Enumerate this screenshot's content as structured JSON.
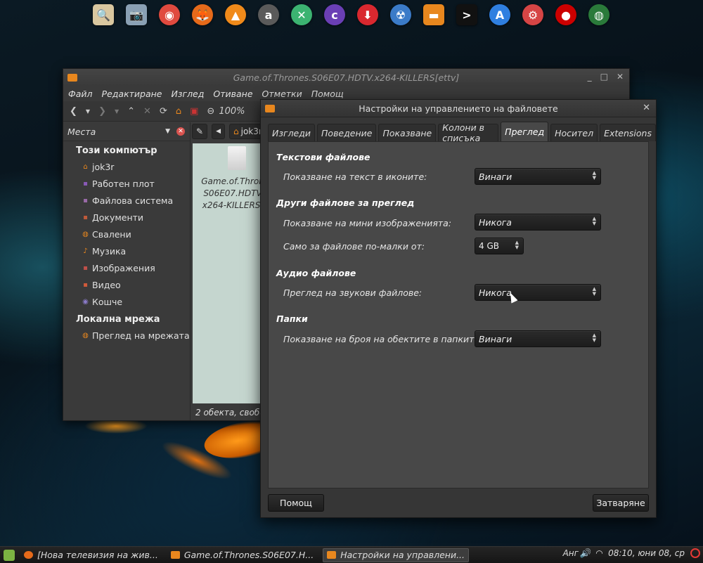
{
  "dock": {
    "icons": [
      {
        "name": "screenshot-tool-icon",
        "glyph": "🔍",
        "color": "#d9c7a0"
      },
      {
        "name": "camera-icon",
        "glyph": "📷",
        "color": "#8aa0b4"
      },
      {
        "name": "chrome-icon",
        "glyph": "◉",
        "color": "#e04a3f"
      },
      {
        "name": "firefox-icon",
        "glyph": "🦊",
        "color": "#e66a1a"
      },
      {
        "name": "vlc-icon",
        "glyph": "▲",
        "color": "#f08a1a"
      },
      {
        "name": "amarok-icon",
        "glyph": "a",
        "color": "#5a5a5a"
      },
      {
        "name": "network-icon",
        "glyph": "✕",
        "color": "#3cb371"
      },
      {
        "name": "clementine-icon",
        "glyph": "c",
        "color": "#6a3fb5"
      },
      {
        "name": "download-icon",
        "glyph": "⬇",
        "color": "#d9282f"
      },
      {
        "name": "radiation-icon",
        "glyph": "☢",
        "color": "#3b7bc8"
      },
      {
        "name": "folder-icon",
        "glyph": "▬",
        "color": "#e8871e"
      },
      {
        "name": "terminal-icon",
        "glyph": ">",
        "color": "#111111"
      },
      {
        "name": "appstore-icon",
        "glyph": "A",
        "color": "#2f7fe0"
      },
      {
        "name": "settings-app-icon",
        "glyph": "⚙",
        "color": "#d64545"
      },
      {
        "name": "redhat-icon",
        "glyph": "●",
        "color": "#cc0000"
      },
      {
        "name": "globe-icon",
        "glyph": "◍",
        "color": "#2a7a3a"
      }
    ]
  },
  "file_manager": {
    "title": "Game.of.Thrones.S06E07.HDTV.x264-KILLERS[ettv]",
    "menu": [
      "Файл",
      "Редактиране",
      "Изглед",
      "Отиване",
      "Отметки",
      "Помощ"
    ],
    "zoom": "100%",
    "sidebar_title": "Места",
    "sections": [
      {
        "title": "Този компютър",
        "items": [
          {
            "label": "jok3r",
            "icon": "home-icon",
            "glyph": "⌂",
            "color": "#e8871e"
          },
          {
            "label": "Работен плот",
            "icon": "desktop-icon",
            "glyph": "▪",
            "color": "#8a5ab8"
          },
          {
            "label": "Файлова система",
            "icon": "filesystem-icon",
            "glyph": "▪",
            "color": "#9a6aa8"
          },
          {
            "label": "Документи",
            "icon": "documents-icon",
            "glyph": "▪",
            "color": "#c05a3a"
          },
          {
            "label": "Свалени",
            "icon": "downloads-icon",
            "glyph": "◍",
            "color": "#e8871e"
          },
          {
            "label": "Музика",
            "icon": "music-icon",
            "glyph": "♪",
            "color": "#e8871e"
          },
          {
            "label": "Изображения",
            "icon": "images-icon",
            "glyph": "▪",
            "color": "#c0504a"
          },
          {
            "label": "Видео",
            "icon": "video-icon",
            "glyph": "▪",
            "color": "#d05a3a"
          },
          {
            "label": "Кошче",
            "icon": "trash-icon",
            "glyph": "◉",
            "color": "#8a7ac8"
          }
        ]
      },
      {
        "title": "Локална мрежа",
        "items": [
          {
            "label": "Преглед на мрежата",
            "icon": "network-browse-icon",
            "glyph": "◍",
            "color": "#e8871e"
          }
        ]
      }
    ],
    "path_button": "jok3r",
    "file_name": "Game.of.Thrones.S06E07.HDTV.x264-KILLERS.",
    "file_name_lines": [
      "Game.of.Thron",
      "S06E07.HDTV",
      "x264-KILLERS."
    ],
    "status": "2 обекта, свобо"
  },
  "dialog": {
    "title": "Настройки на управлението на файловете",
    "tabs": [
      "Изгледи",
      "Поведение",
      "Показване",
      "Колони в списъка",
      "Преглед",
      "Носител",
      "Extensions"
    ],
    "active_tab": "Преглед",
    "sections": {
      "text_files": {
        "title": "Текстови файлове",
        "label": "Показване на текст в иконите:",
        "value": "Винаги"
      },
      "other_files": {
        "title": "Други файлове за преглед",
        "thumb_label": "Показване на мини изображенията:",
        "thumb_value": "Никога",
        "size_label": "Само за файлове по-малки от:",
        "size_value": "4 GB"
      },
      "audio": {
        "title": "Аудио файлове",
        "label": "Преглед на звукови файлове:",
        "value": "Никога"
      },
      "folders": {
        "title": "Папки",
        "label": "Показване на броя на обектите в папките:",
        "value": "Винаги"
      }
    },
    "help_button": "Помощ",
    "close_button": "Затваряне"
  },
  "taskbar": {
    "tasks": [
      {
        "label": "[Нова телевизия на жив...",
        "color": "#e66a1a"
      },
      {
        "label": "Game.of.Thrones.S06E07.H...",
        "color": "#e8871e"
      },
      {
        "label": "Настройки на управлени...",
        "color": "#e8871e"
      }
    ],
    "layout": "Анг",
    "clock": "08:10, юни 08, ср"
  }
}
